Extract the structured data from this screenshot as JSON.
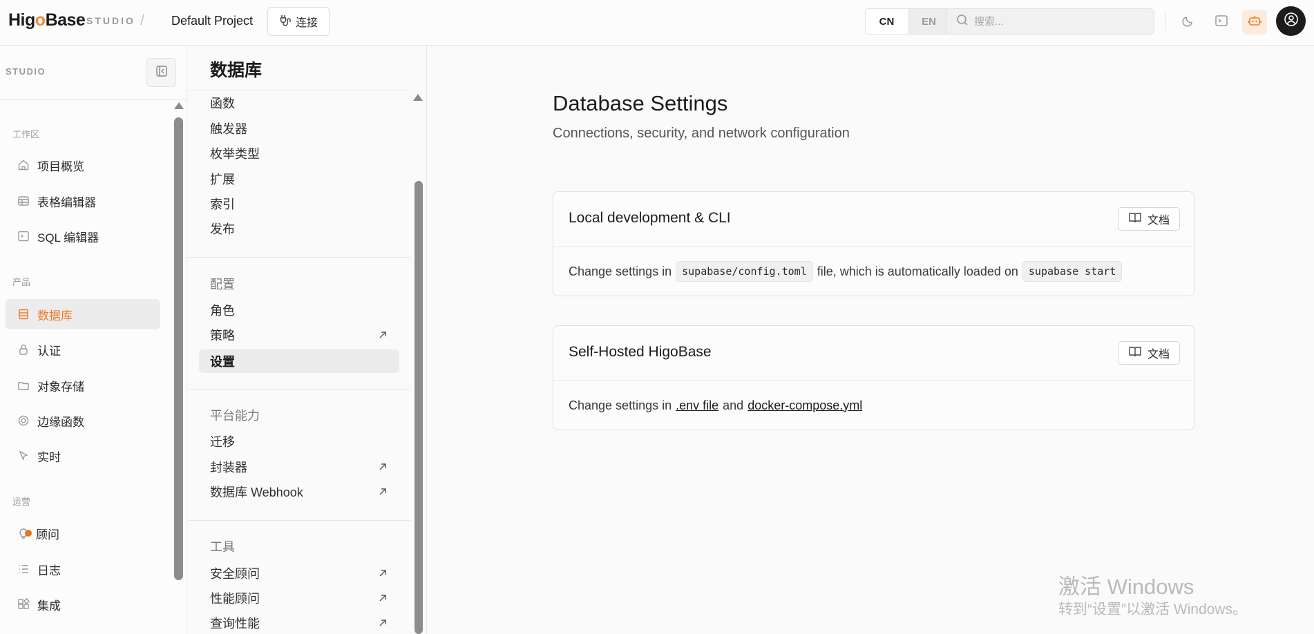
{
  "topbar": {
    "logo_pre": "Hig",
    "logo_o": "o",
    "logo_post": "Base",
    "studio_tag": "STUDIO",
    "separator": "/",
    "project_name": "Default Project",
    "connect_label": "连接",
    "lang_cn": "CN",
    "lang_en": "EN",
    "search_placeholder": "搜索..."
  },
  "sidebar": {
    "studio_label": "STUDIO",
    "sections": {
      "workspace": "工作区",
      "product": "产品",
      "ops": "运营"
    },
    "items": [
      {
        "label": "项目概览",
        "icon": "home-icon"
      },
      {
        "label": "表格编辑器",
        "icon": "table-icon"
      },
      {
        "label": "SQL 编辑器",
        "icon": "terminal-icon"
      },
      {
        "label": "数据库",
        "icon": "database-icon",
        "active": true
      },
      {
        "label": "认证",
        "icon": "lock-icon"
      },
      {
        "label": "对象存储",
        "icon": "folder-icon"
      },
      {
        "label": "边缘函数",
        "icon": "edge-functions-icon"
      },
      {
        "label": "实时",
        "icon": "cursor-icon"
      },
      {
        "label": "顾问",
        "icon": "lightbulb-icon"
      },
      {
        "label": "日志",
        "icon": "list-icon"
      },
      {
        "label": "集成",
        "icon": "integrations-icon"
      }
    ]
  },
  "menu": {
    "title": "数据库",
    "items_top": [
      "函数",
      "触发器",
      "枚举类型",
      "扩展",
      "索引",
      "发布"
    ],
    "config_section": "配置",
    "config_items": [
      {
        "label": "角色",
        "external": false
      },
      {
        "label": "策略",
        "external": true
      },
      {
        "label": "设置",
        "external": false,
        "active": true
      }
    ],
    "platform_section": "平台能力",
    "platform_items": [
      {
        "label": "迁移",
        "external": false
      },
      {
        "label": "封装器",
        "external": true
      },
      {
        "label": "数据库 Webhook",
        "external": true
      }
    ],
    "tools_section": "工具",
    "tools_items": [
      {
        "label": "安全顾问",
        "external": true
      },
      {
        "label": "性能顾问",
        "external": true
      },
      {
        "label": "查询性能",
        "external": true
      }
    ]
  },
  "main": {
    "title": "Database Settings",
    "subtitle": "Connections, security, and network configuration",
    "card1": {
      "title": "Local development & CLI",
      "doc_label": "文档",
      "text_a": "Change settings in",
      "code_a": "supabase/config.toml",
      "text_b": "file, which is automatically loaded on",
      "code_b": "supabase start"
    },
    "card2": {
      "title": "Self-Hosted HigoBase",
      "doc_label": "文档",
      "text_a": "Change settings in",
      "link_a": ".env file",
      "text_b": "and",
      "link_b": "docker-compose.yml"
    }
  },
  "watermark": {
    "line1": "激活 Windows",
    "line2": "转到“设置”以激活 Windows。"
  },
  "colors": {
    "accent": "#f07a2a",
    "advisor_dot": "#e07a1f"
  }
}
